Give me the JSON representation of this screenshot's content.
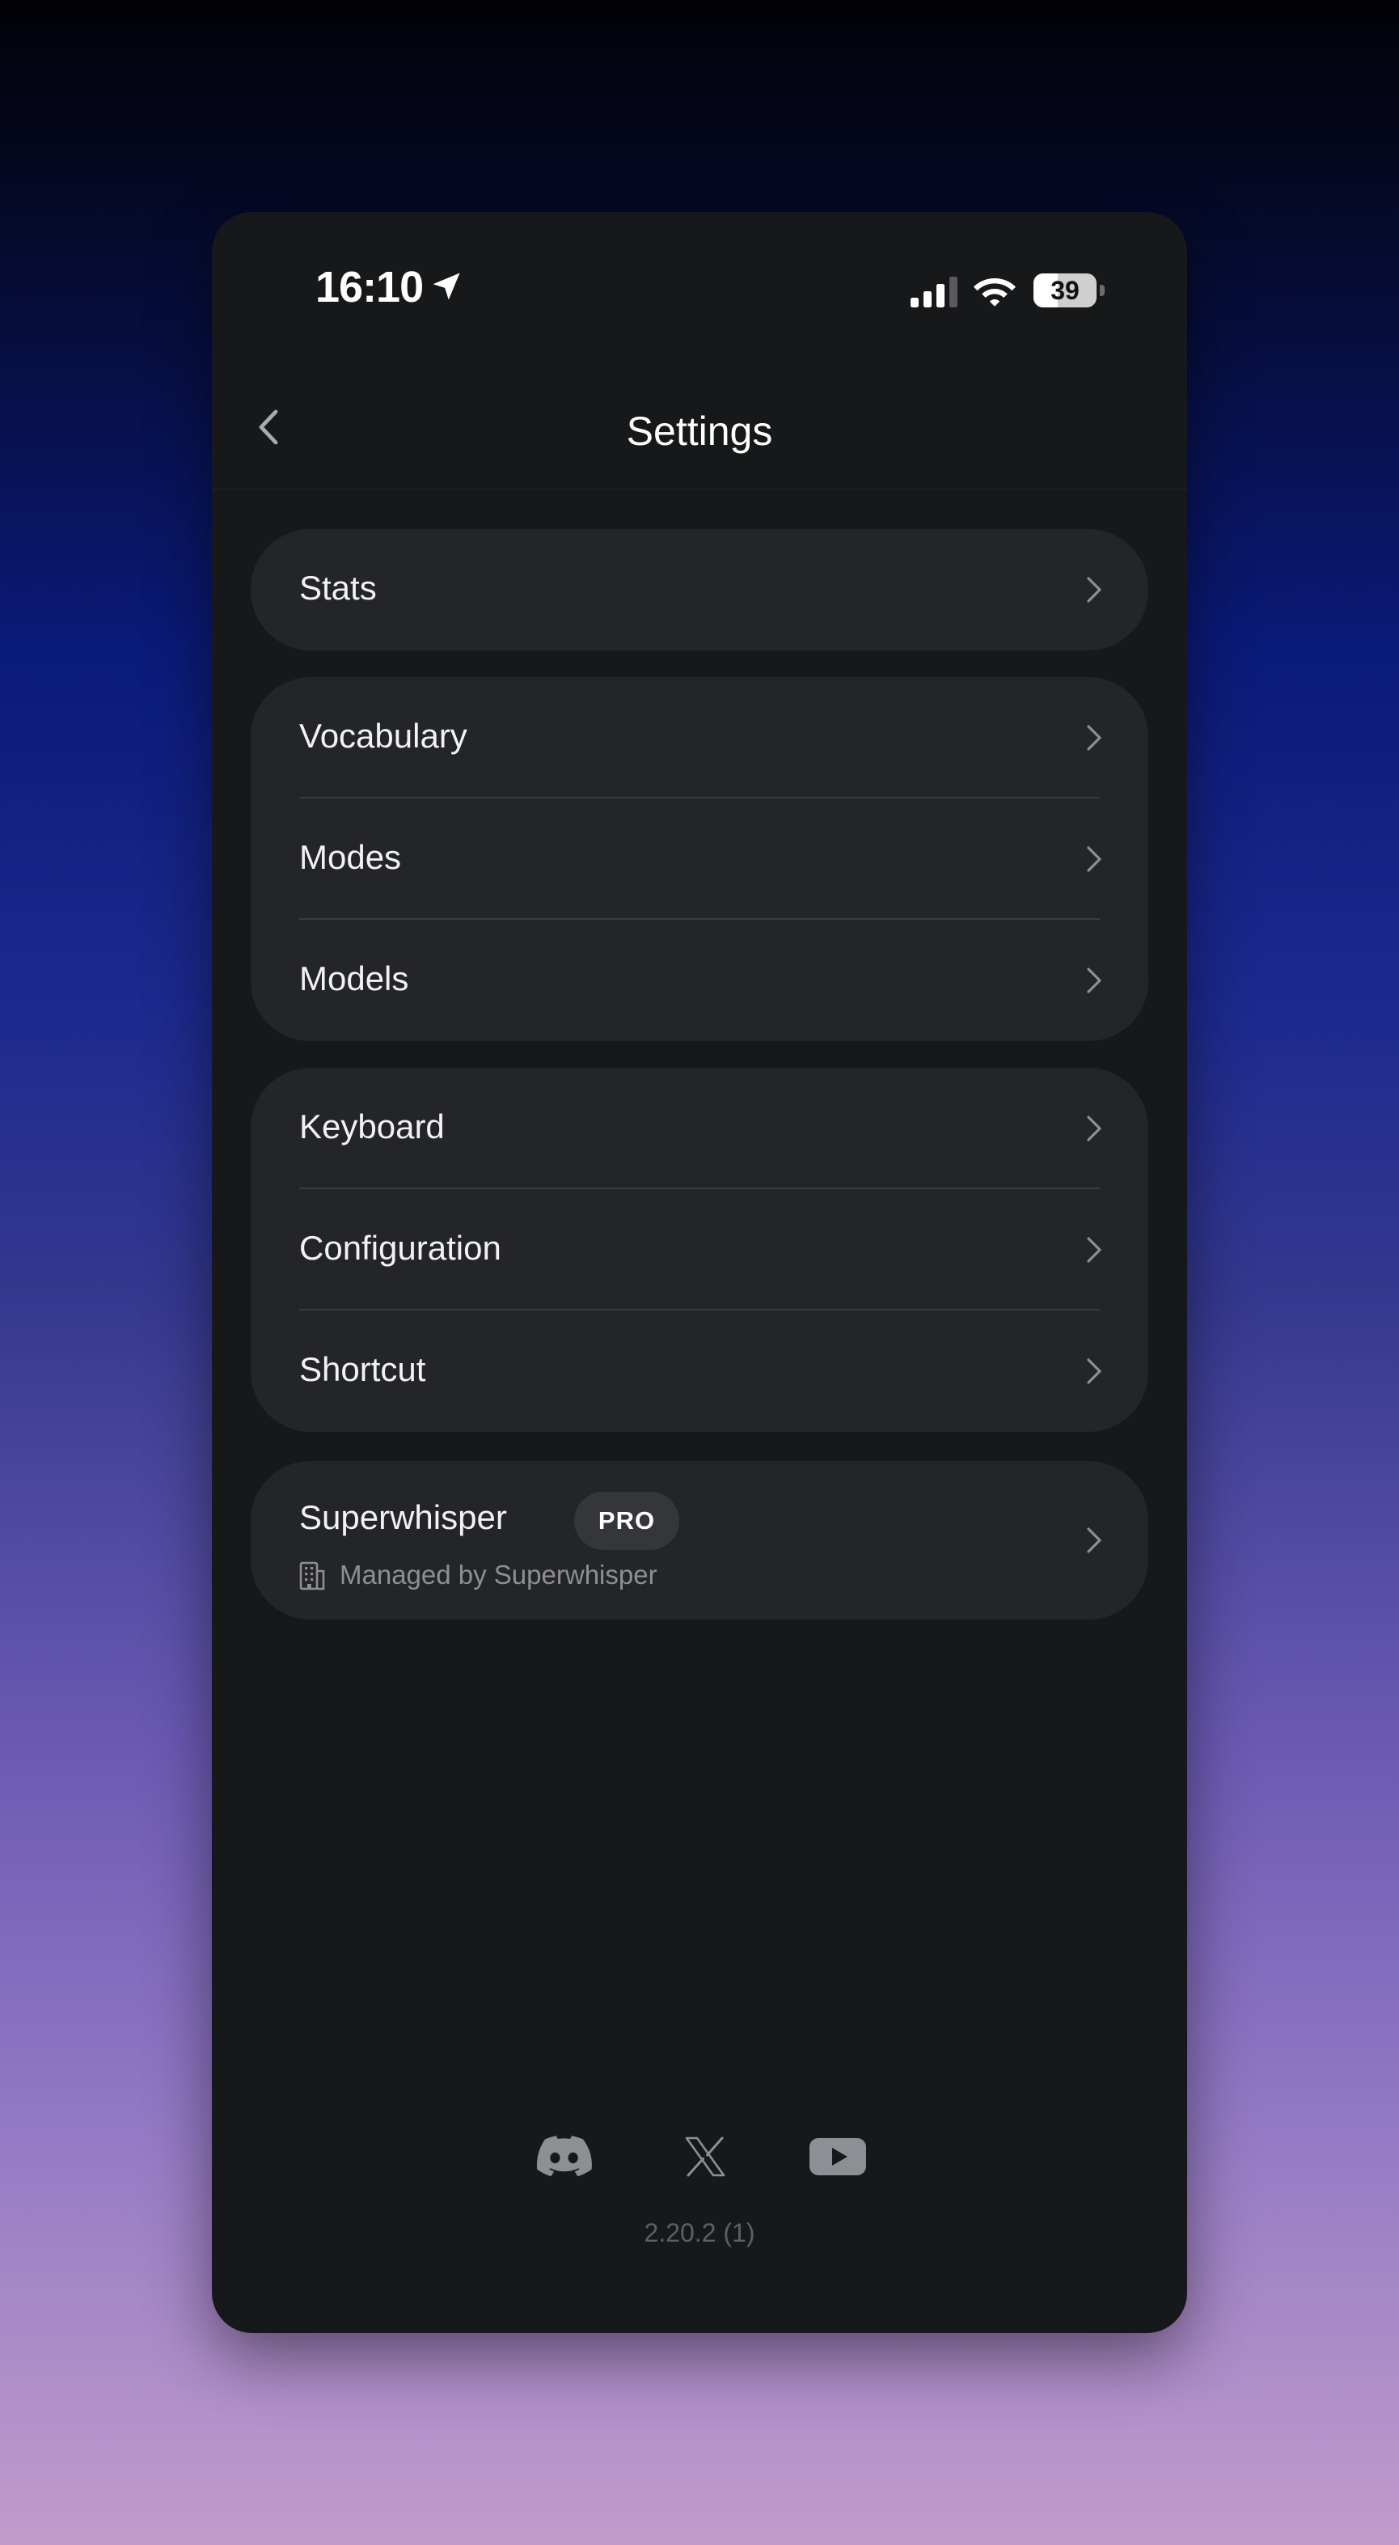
{
  "status_bar": {
    "time": "16:10",
    "battery_level": "39",
    "battery_fraction": 0.39,
    "icons": [
      "location-arrow-icon",
      "cellular-signal-icon",
      "wifi-icon",
      "battery-icon"
    ]
  },
  "nav": {
    "title": "Settings",
    "back_icon": "chevron-left-icon"
  },
  "groups": [
    {
      "items": [
        {
          "label": "Stats"
        }
      ]
    },
    {
      "items": [
        {
          "label": "Vocabulary"
        },
        {
          "label": "Modes"
        },
        {
          "label": "Models"
        }
      ]
    },
    {
      "items": [
        {
          "label": "Keyboard"
        },
        {
          "label": "Configuration"
        },
        {
          "label": "Shortcut"
        }
      ]
    }
  ],
  "account": {
    "name": "Superwhisper",
    "badge": "PRO",
    "managed_by": "Managed by Superwhisper",
    "icon": "building-icon"
  },
  "footer": {
    "social": [
      "discord-icon",
      "x-icon",
      "youtube-icon"
    ],
    "version": "2.20.2 (1)"
  },
  "colors": {
    "panel_bg": "#17181a",
    "card_bg": "#242528",
    "text": "#f2f2f2",
    "secondary_text": "#8e8f94"
  }
}
